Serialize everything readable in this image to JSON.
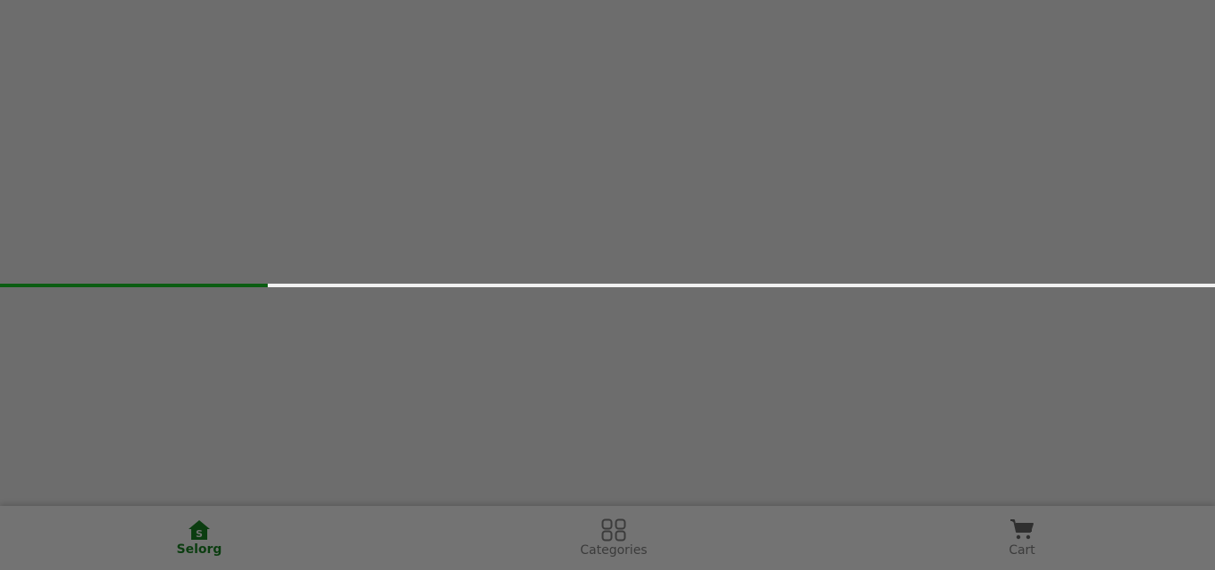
{
  "loading": {
    "progress": 0.22,
    "fill_color": "#0b5d12",
    "track_color": "#f1f1f1"
  },
  "bottom_nav": {
    "items": [
      {
        "label": "Selorg",
        "icon": "home-s-icon",
        "active": true
      },
      {
        "label": "Categories",
        "icon": "grid-icon",
        "active": false
      },
      {
        "label": "Cart",
        "icon": "cart-icon",
        "active": false
      }
    ],
    "active_color": "#0b3d10",
    "inactive_color": "#3b3b3b"
  }
}
